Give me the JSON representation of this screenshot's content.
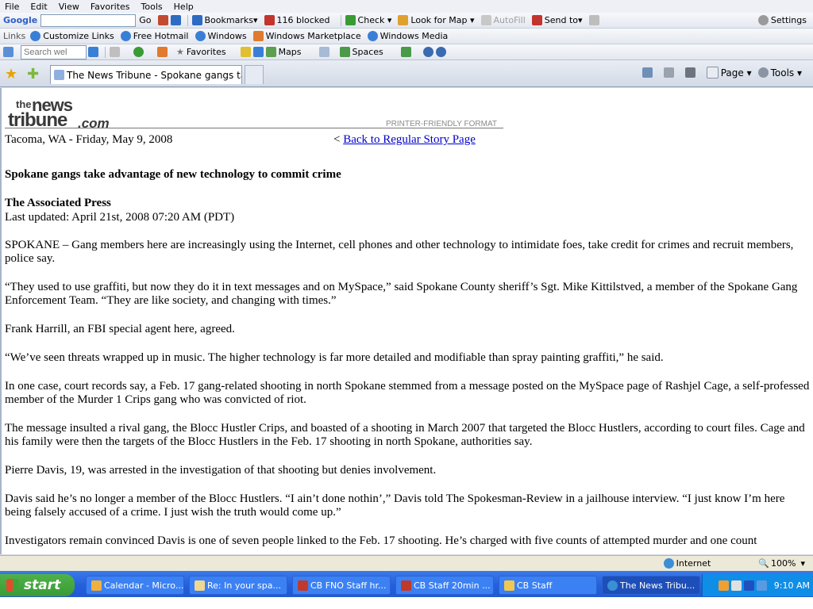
{
  "menu": [
    "File",
    "Edit",
    "View",
    "Favorites",
    "Tools",
    "Help"
  ],
  "google_bar": {
    "brand": "Google",
    "go": "Go",
    "bookmarks": "Bookmarks▾",
    "blocked": "116 blocked",
    "check": "Check ▾",
    "look_for_map": "Look for Map ▾",
    "autofill": "AutoFill",
    "send_to": "Send to▾",
    "settings": "Settings"
  },
  "links_bar": {
    "label": "Links",
    "items": [
      "Customize Links",
      "Free Hotmail",
      "Windows",
      "Windows Marketplace",
      "Windows Media"
    ]
  },
  "fav_bar": {
    "search_placeholder": "Search wel",
    "favorites": "Favorites",
    "maps": "Maps",
    "spaces": "Spaces"
  },
  "tabs": {
    "active_title": "The News Tribune - Spokane gangs take a..."
  },
  "command_bar": {
    "page": "Page ▾",
    "tools": "Tools ▾"
  },
  "page": {
    "logo_the": "the",
    "logo_news": "news",
    "logo_tribune": "tribune",
    "logo_com": ".com",
    "printer_friendly": "PRINTER-FRIENDLY FORMAT",
    "dateline": "Tacoma, WA - Friday, May 9, 2008",
    "back_prefix": "< ",
    "back_link": "Back to Regular Story Page",
    "headline": "Spokane gangs take advantage of new technology to commit crime",
    "byline": "The Associated Press",
    "updated": "Last updated: April 21st, 2008 07:20 AM (PDT)",
    "paragraphs": [
      "SPOKANE – Gang members here are increasingly using the Internet, cell phones and other technology to intimidate foes, take credit for crimes and recruit members, police say.",
      "“They used to use graffiti, but now they do it in text messages and on MySpace,” said Spokane County sheriff’s Sgt. Mike Kittilstved, a member of the Spokane Gang Enforcement Team. “They are like society, and changing with times.”",
      "Frank Harrill, an FBI special agent here, agreed.",
      "“We’ve seen threats wrapped up in music. The higher technology is far more detailed and modifiable than spray painting graffiti,” he said.",
      "In one case, court records say, a Feb. 17 gang-related shooting in north Spokane stemmed from a message posted on the MySpace page of Rashjel Cage, a self-professed member of the Murder 1 Crips gang who was convicted of riot.",
      "The message insulted a rival gang, the Blocc Hustler Crips, and boasted of a shooting in March 2007 that targeted the Blocc Hustlers, according to court files. Cage and his family were then the targets of the Blocc Hustlers in the Feb. 17 shooting in north Spokane, authorities say.",
      "Pierre Davis, 19, was arrested in the investigation of that shooting but denies involvement.",
      "Davis said he’s no longer a member of the Blocc Hustlers. “I ain’t done nothin’,” Davis told The Spokesman-Review in a jailhouse interview. “I just know I’m here being falsely accused of a crime. I just wish the truth would come up.”",
      "Investigators remain convinced Davis is one of seven people linked to the Feb. 17 shooting. He’s charged with five counts of attempted murder and one count"
    ]
  },
  "status_bar": {
    "zone": "Internet",
    "zoom": "100%"
  },
  "taskbar": {
    "start": "start",
    "items": [
      "Calendar - Micro...",
      "Re: In your spa...",
      "CB FNO Staff hr...",
      "CB Staff 20min ...",
      "CB Staff",
      "The News Tribu..."
    ],
    "clock": "9:10 AM"
  },
  "colors": {
    "link": "#0000cc",
    "taskbar": "#245edb",
    "start": "#3a9b35"
  }
}
